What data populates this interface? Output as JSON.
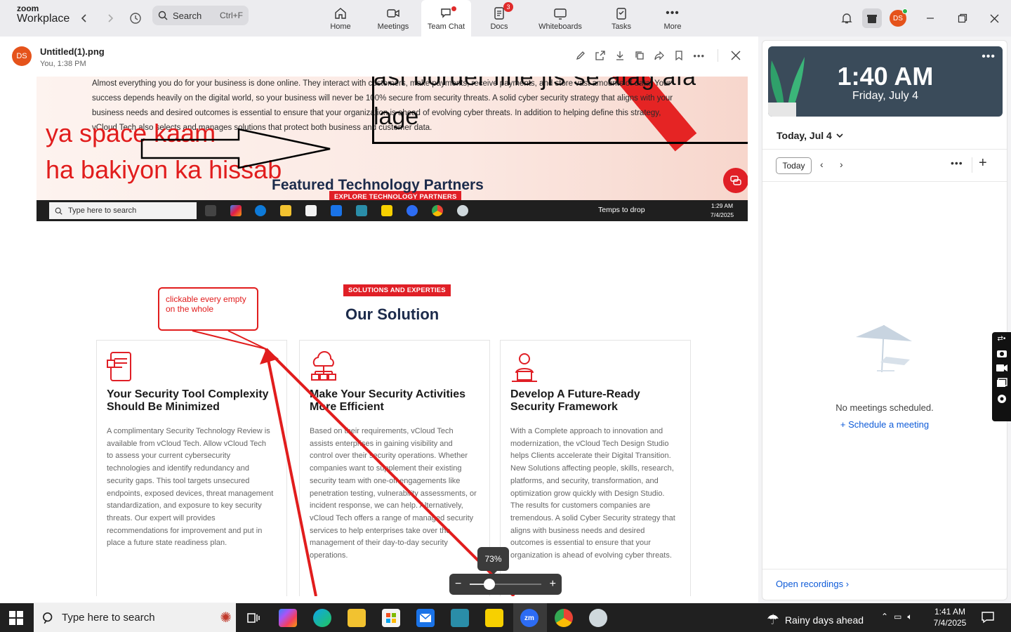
{
  "app": {
    "brand_small": "zoom",
    "brand_large": "Workplace"
  },
  "search": {
    "label": "Search",
    "shortcut": "Ctrl+F"
  },
  "nav_tabs": [
    {
      "label": "Home",
      "icon": "home-icon"
    },
    {
      "label": "Meetings",
      "icon": "video-icon"
    },
    {
      "label": "Team Chat",
      "icon": "chat-icon",
      "active": true,
      "dot": true
    },
    {
      "label": "Docs",
      "icon": "docs-icon",
      "badge": "3"
    },
    {
      "label": "Whiteboards",
      "icon": "whiteboard-icon"
    },
    {
      "label": "Tasks",
      "icon": "tasks-icon"
    },
    {
      "label": "More",
      "icon": "more-icon"
    }
  ],
  "user": {
    "initials": "DS",
    "status_color": "#2bb34a"
  },
  "viewer": {
    "file_name": "Untitled(1).png",
    "file_sub": "You, 1:38 PM",
    "sender_initials": "DS"
  },
  "image": {
    "hero_text": "Almost everything you do for your business is done online. They interact with customers, make payments, receive payments, and store vast amounts of data. Your success depends heavily on the digital world, so your business will never be 100% secure from security threats. A solid cyber security strategy that aligns with your business needs and desired outcomes is essential to ensure that your organization is ahead of evolving cyber threats. In addition to helping define this strategy, vCloud Tech also selects and manages solutions that protect both business and customer data.",
    "overlay_line1": "asi border line jis se alag ala",
    "overlay_line2": "lage",
    "handwriting_1": "ya space kaam",
    "handwriting_2": "ha bakiyon ka hissab",
    "tag1": "EXPLORE TECHNOLOGY PARTNERS",
    "heading1": "Featured Technology Partners",
    "inner_taskbar": {
      "search_placeholder": "Type here to search",
      "temp": "Temps to drop",
      "time": "1:29 AM",
      "date": "7/4/2025"
    },
    "tag2": "SOLUTIONS AND EXPERTIES",
    "heading2": "Our Solution",
    "callout": "clickable every empty on the whole",
    "cards": [
      {
        "title": "Your Security Tool Complexity Should Be Minimized",
        "body": "A complimentary Security Technology Review is available from vCloud Tech. Allow vCloud Tech to assess your current cybersecurity technologies and identify redundancy and security gaps. This tool targets unsecured endpoints, exposed devices, threat management standardization, and exposure to key security threats. Our expert will provides recommendations for improvement and put in place a future state readiness plan."
      },
      {
        "title": "Make Your Security Activities More Efficient",
        "body": "Based on their requirements, vCloud Tech assists enterprises in gaining visibility and control over their security operations. Whether companies want to supplement their existing security team with one-off engagements like penetration testing, vulnerability assessments, or incident response, we can help. Alternatively, vCloud Tech offers a range of managed security services to help enterprises take over the management of their day-to-day security operations."
      },
      {
        "title": "Develop A Future-Ready Security Framework",
        "body": "With a Complete approach to innovation and modernization, the vCloud Tech Design Studio helps Clients accelerate their Digital Transition. New Solutions affecting people, skills, research, platforms, and security, transformation, and optimization grow quickly with Design Studio. The results for customers companies are tremendous. A solid Cyber Security strategy that aligns with business needs and desired outcomes is essential to ensure that your organization is ahead of evolving cyber threats."
      }
    ]
  },
  "zoom": {
    "label": "73%",
    "value": 0.27
  },
  "calendar": {
    "time": "1:40 AM",
    "date": "Friday, July 4",
    "today_header": "Today, Jul 4",
    "today_button": "Today",
    "empty_text": "No meetings scheduled.",
    "schedule_link": "Schedule a meeting",
    "recordings_link": "Open recordings"
  },
  "taskbar": {
    "search_placeholder": "Type here to search",
    "weather": "Rainy days ahead",
    "time": "1:41 AM",
    "date": "7/4/2025"
  },
  "colors": {
    "accent_red": "#e01f26",
    "link_blue": "#0e5bd8",
    "brand_orange": "#e5531b"
  }
}
